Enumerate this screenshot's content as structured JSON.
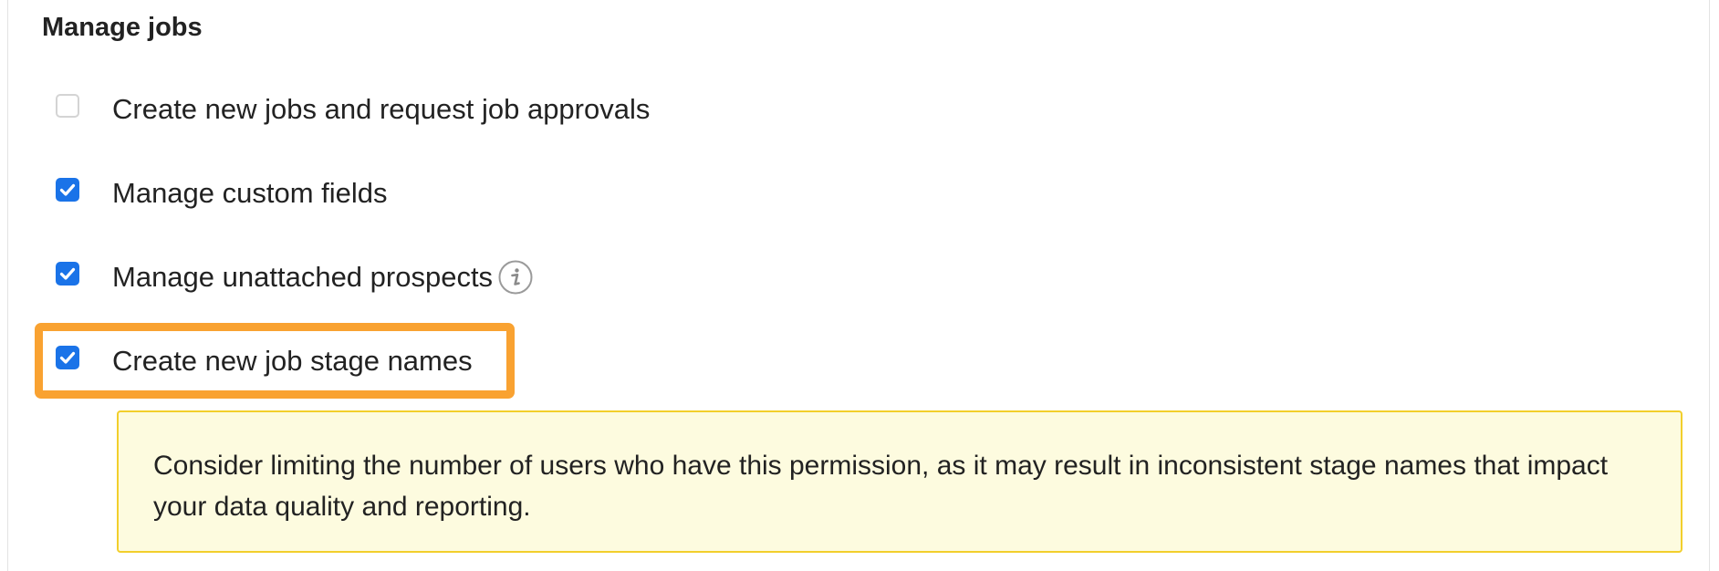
{
  "section": {
    "title": "Manage jobs"
  },
  "permissions": [
    {
      "label": "Create new jobs and request job approvals",
      "checked": false
    },
    {
      "label": "Manage custom fields",
      "checked": true
    },
    {
      "label": "Manage unattached prospects",
      "checked": true,
      "info_icon": "info-icon"
    },
    {
      "label": "Create new job stage names",
      "checked": true
    }
  ],
  "notice": {
    "text": "Consider limiting the number of users who have this permission, as it may result in inconsistent stage names that impact your data quality and reporting."
  },
  "colors": {
    "checkbox_checked": "#1a73e8",
    "highlight": "#f9a231",
    "notice_background": "#fdfbdf",
    "notice_border": "#f2cf2c"
  }
}
